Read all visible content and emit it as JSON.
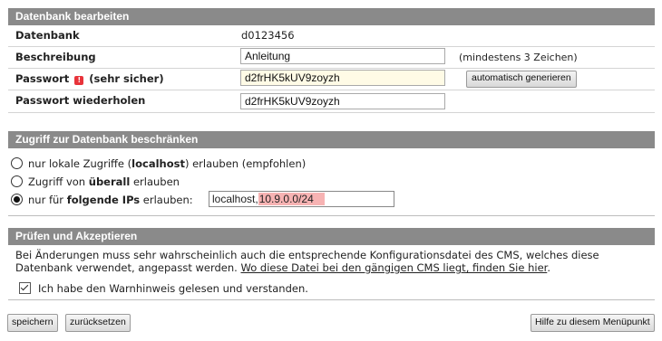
{
  "edit": {
    "header": "Datenbank bearbeiten",
    "database_label": "Datenbank",
    "database_value": "d0123456",
    "description_label": "Beschreibung",
    "description_value": "Anleitung",
    "description_hint": "(mindestens 3 Zeichen)",
    "password_label": "Passwort",
    "password_strength": "(sehr sicher)",
    "password_value": "d2frHK5kUV9zoyzh",
    "generate_button": "automatisch generieren",
    "repeat_label": "Passwort wiederholen",
    "repeat_value": "d2frHK5kUV9zoyzh"
  },
  "access": {
    "header": "Zugriff zur Datenbank beschränken",
    "opt1_pre": "nur lokale Zugriffe (",
    "opt1_bold": "localhost",
    "opt1_post": ") erlauben (empfohlen)",
    "opt2_pre": "Zugriff von ",
    "opt2_bold": "überall",
    "opt2_post": " erlauben",
    "opt3_pre": "nur für ",
    "opt3_bold": "folgende IPs",
    "opt3_post": " erlauben:",
    "ip_plain": "localhost,",
    "ip_highlight": "10.9.0.0/24",
    "selected": 3
  },
  "review": {
    "header": "Prüfen und Akzeptieren",
    "text": "Bei Änderungen muss sehr wahrscheinlich auch die entsprechende Konfigurationsdatei des CMS, welches diese Datenbank verwendet, angepasst werden. ",
    "link": "Wo diese Datei bei den gängigen CMS liegt, finden Sie hier",
    "link_after": ".",
    "checkbox_label": "Ich habe den Warnhinweis gelesen und verstanden.",
    "checkbox_checked": true
  },
  "footer": {
    "save": "speichern",
    "reset": "zurücksetzen",
    "help": "Hilfe zu diesem Menüpunkt"
  },
  "icons": {
    "password_strength_icon": "shield-alert-icon",
    "strength_color": "#e8333a",
    "ip_highlight_color": "#f7b3b3"
  }
}
